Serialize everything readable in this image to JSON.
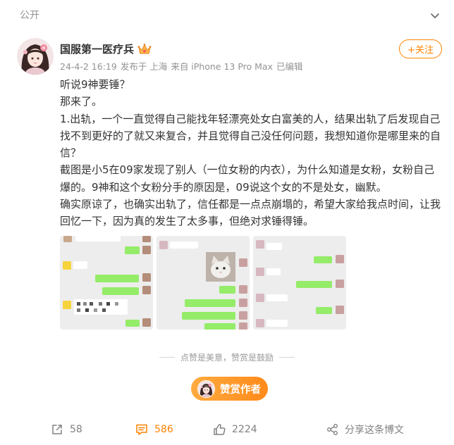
{
  "header": {
    "visibility": "公开",
    "menu_icon": "chevron-down-icon"
  },
  "author": {
    "name": "国服第一医疗兵",
    "badge_icon": "crown-badge-icon",
    "avatar_icon": "avatar"
  },
  "follow_button": {
    "label": "+关注"
  },
  "meta": {
    "datetime": "24-4-2 16:19",
    "location": "发布于 上海",
    "source": "来自 iPhone 13 Pro Max",
    "edited": "已编辑"
  },
  "post": {
    "paragraphs": [
      "听说9神要锤？",
      "那来了。",
      "1.出轨，一个一直觉得自己能找年轻漂亮处女白富美的人，结果出轨了后发现自己找不到更好的了就又来复合，并且觉得自己没任何问题，我想知道你是哪里来的自信？",
      "截图是小5在09家发现了别人（一位女粉的内衣），为什么知道是女粉，女粉自己爆的。9神和这个女粉分手的原因是，09说这个女的不是处女，幽默。",
      "确实原谅了，也确实出轨了，信任都是一点点崩塌的，希望大家给我点时间，让我回忆一下，因为真的发生了太多事，但绝对求锤得锤。"
    ]
  },
  "reward": {
    "tagline": "点赞是美意，赞赏是鼓励",
    "button_label": "赞赏作者"
  },
  "actions": {
    "repost": {
      "icon": "repost-icon",
      "count": "58"
    },
    "comment": {
      "icon": "comment-icon",
      "count": "586"
    },
    "like": {
      "icon": "thumbs-up-icon",
      "count": "2224"
    },
    "share": {
      "icon": "share-icon",
      "label": "分享这条博文"
    }
  },
  "colors": {
    "accent": "#ff8200",
    "text": "#333333",
    "muted": "#939393",
    "chat_bubble_green": "#95ec69"
  }
}
